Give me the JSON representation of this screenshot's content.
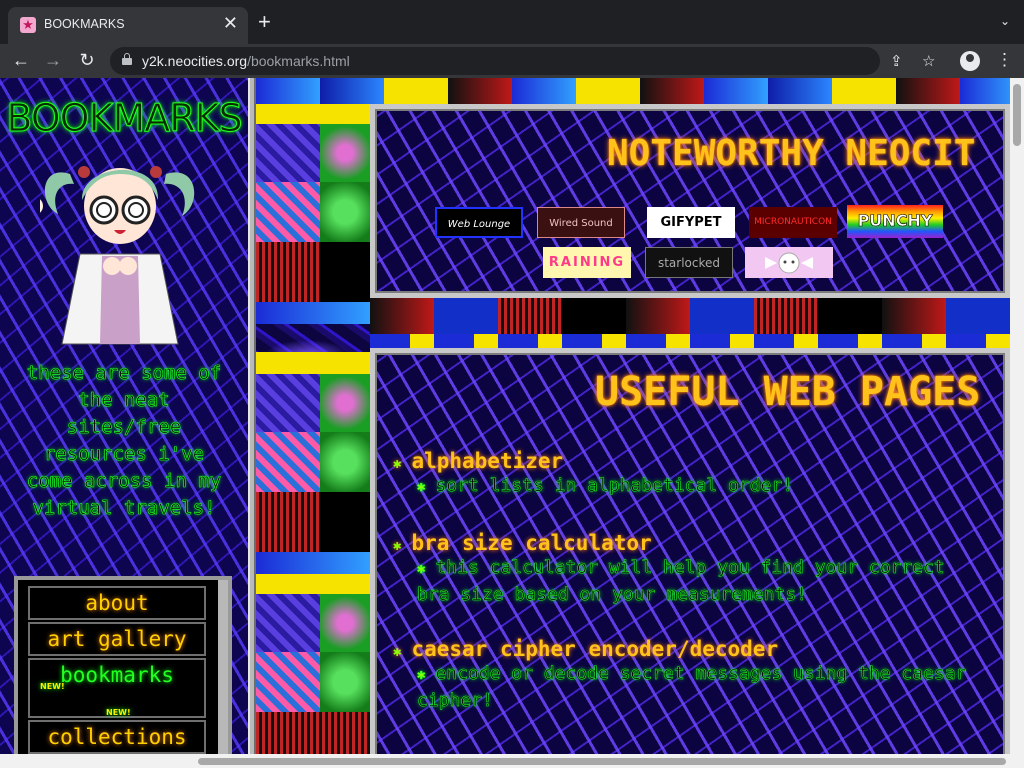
{
  "browser": {
    "tab_title": "BOOKMARKS",
    "tab_close": "✕",
    "new_tab": "+",
    "tab_menu": "⌄",
    "url_host": "y2k.neocities.org",
    "url_path": "/bookmarks.html",
    "nav_back": "←",
    "nav_forward": "→",
    "nav_reload": "↻",
    "share_icon": "⇪",
    "star_icon": "☆",
    "menu_icon": "⋮"
  },
  "sidebar": {
    "title": "BOOKMARKS",
    "blurb": "these are some of the neat sites/free resources i've come across in my virtual travels!",
    "nav": [
      {
        "label": "about",
        "color": "#ffd000"
      },
      {
        "label": "art gallery",
        "color": "#ffd000"
      },
      {
        "label": "bookmarks",
        "color": "#22ff22",
        "badge": "NEW!"
      },
      {
        "label": "collections",
        "color": "#ffd000"
      }
    ]
  },
  "noteworthy": {
    "title": "NOTEWORTHY NEOCIT",
    "buttons_row1": [
      "Web Lounge",
      "Wired Sound",
      "GIFYPET",
      "MICRONAUTICON",
      "PUNCHY"
    ],
    "buttons_row2": [
      "RAINING",
      "starlocked",
      ""
    ]
  },
  "useful": {
    "title": "USEFUL WEB PAGES",
    "items": [
      {
        "name": "alphabetizer",
        "desc": "sort lists in alphabetical order!"
      },
      {
        "name": "bra size calculator",
        "desc": "this calculator will help you find your correct bra size based on your measurements!"
      },
      {
        "name": "caesar cipher encoder/decoder",
        "desc": "encode or decode secret messages using the caesar cipher!"
      }
    ]
  }
}
